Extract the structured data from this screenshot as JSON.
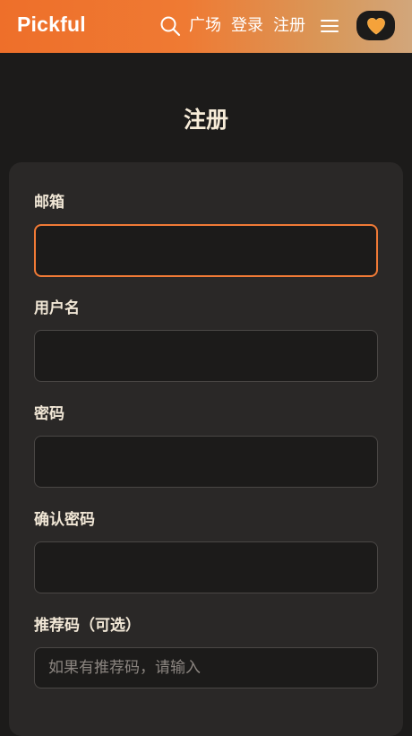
{
  "header": {
    "logo": "Pickful",
    "nav": {
      "plaza": "广场",
      "login": "登录",
      "register": "注册"
    },
    "icons": {
      "search": "search-icon",
      "menu": "menu-icon",
      "heart": "heart-icon"
    },
    "gradient": [
      "#ee6f2a",
      "#d2a67b"
    ]
  },
  "main": {
    "title": "注册",
    "form": {
      "email_label": "邮箱",
      "email_value": "",
      "username_label": "用户名",
      "username_value": "",
      "password_label": "密码",
      "password_value": "",
      "confirm_label": "确认密码",
      "confirm_value": "",
      "referral_label": "推荐码（可选）",
      "referral_placeholder": "如果有推荐码，请输入",
      "referral_value": ""
    }
  },
  "colors": {
    "background": "#1c1b1a",
    "card": "#2a2827",
    "accent": "#f07a36",
    "text": "#f1e7d6"
  }
}
